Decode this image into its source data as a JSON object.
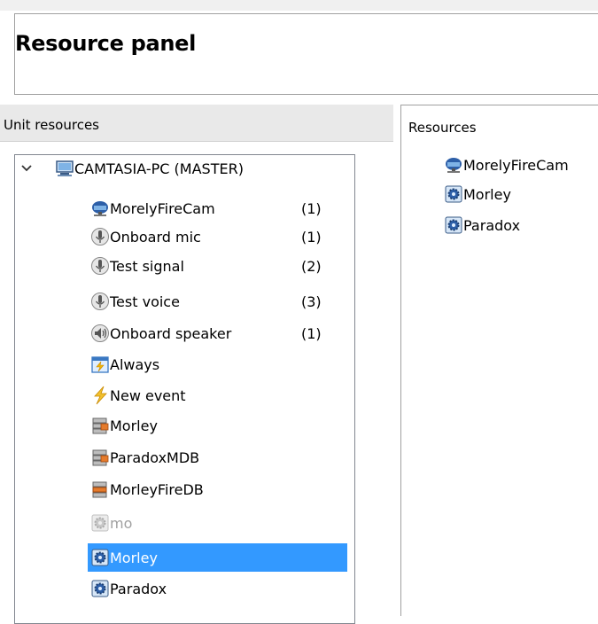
{
  "panel_title": "Resource panel",
  "left_pane": {
    "header": "Unit resources"
  },
  "tree": {
    "root": {
      "label": "CAMTASIA-PC (MASTER)",
      "icon": "computer-icon",
      "expanded": true
    },
    "items": [
      {
        "label": "MorelyFireCam",
        "count": "(1)",
        "icon": "camera-icon"
      },
      {
        "label": "Onboard mic",
        "count": "(1)",
        "icon": "microphone-icon"
      },
      {
        "label": "Test signal",
        "count": "(2)",
        "icon": "microphone-icon"
      },
      {
        "label": "Test voice",
        "count": "(3)",
        "icon": "microphone-icon"
      },
      {
        "label": "Onboard speaker",
        "count": "(1)",
        "icon": "speaker-icon"
      },
      {
        "label": "Always",
        "count": "",
        "icon": "calendar-icon"
      },
      {
        "label": "New event",
        "count": "",
        "icon": "lightning-icon"
      },
      {
        "label": "Morley",
        "count": "",
        "icon": "database-icon"
      },
      {
        "label": "ParadoxMDB",
        "count": "",
        "icon": "database-icon"
      },
      {
        "label": "MorleyFireDB",
        "count": "",
        "icon": "database-icon"
      },
      {
        "label": "mo",
        "count": "",
        "icon": "gear-icon",
        "state": "disabled"
      },
      {
        "label": "Morley",
        "count": "",
        "icon": "gear-icon",
        "state": "selected"
      },
      {
        "label": "Paradox",
        "count": "",
        "icon": "gear-icon"
      }
    ]
  },
  "right_pane": {
    "header": "Resources",
    "items": [
      {
        "label": "MorelyFireCam",
        "icon": "camera-icon"
      },
      {
        "label": "Morley",
        "icon": "gear-icon"
      },
      {
        "label": "Paradox",
        "icon": "gear-icon"
      }
    ]
  },
  "colors": {
    "selection": "#3399ff",
    "disabled_text": "#a0a0a0"
  }
}
